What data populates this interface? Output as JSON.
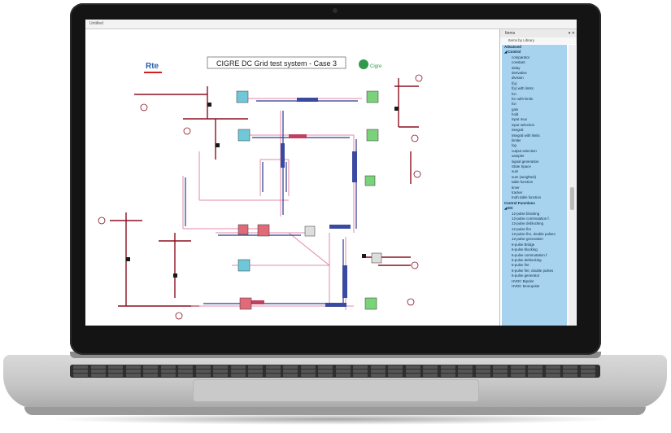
{
  "window": {
    "title": "Untitled"
  },
  "diagram": {
    "title": "CIGRE DC Grid test system - Case 3",
    "logo_left": "Rte",
    "logo_right": "Cigre"
  },
  "panel": {
    "title": "Items",
    "controls": "▾ ✕",
    "subheader": "Items by Library",
    "tree": [
      {
        "label": "Advanced",
        "kind": "h"
      },
      {
        "label": "◢ Control",
        "kind": "h"
      },
      {
        "label": "comparator",
        "kind": "i"
      },
      {
        "label": "constant",
        "kind": "i"
      },
      {
        "label": "delay",
        "kind": "i"
      },
      {
        "label": "derivative",
        "kind": "i"
      },
      {
        "label": "division",
        "kind": "i"
      },
      {
        "label": "f(u)",
        "kind": "i"
      },
      {
        "label": "f(u) with limits",
        "kind": "i"
      },
      {
        "label": "fcn",
        "kind": "i"
      },
      {
        "label": "fcn with limits",
        "kind": "i"
      },
      {
        "label": "fcn",
        "kind": "i"
      },
      {
        "label": "gain",
        "kind": "i"
      },
      {
        "label": "hold",
        "kind": "i"
      },
      {
        "label": "input mux",
        "kind": "i"
      },
      {
        "label": "input selection",
        "kind": "i"
      },
      {
        "label": "integral",
        "kind": "i"
      },
      {
        "label": "integral with limits",
        "kind": "i"
      },
      {
        "label": "limiter",
        "kind": "i"
      },
      {
        "label": "log",
        "kind": "i"
      },
      {
        "label": "output selection",
        "kind": "i"
      },
      {
        "label": "sampler",
        "kind": "i"
      },
      {
        "label": "signal generation",
        "kind": "i"
      },
      {
        "label": "State Space",
        "kind": "i"
      },
      {
        "label": "sum",
        "kind": "i"
      },
      {
        "label": "sum (weighted)",
        "kind": "i"
      },
      {
        "label": "table function",
        "kind": "i"
      },
      {
        "label": "timer",
        "kind": "i"
      },
      {
        "label": "tracker",
        "kind": "i"
      },
      {
        "label": "truth table function",
        "kind": "i"
      },
      {
        "label": "Control Functions",
        "kind": "h"
      },
      {
        "label": "◢ DC",
        "kind": "h"
      },
      {
        "label": "12-pulse blocking",
        "kind": "i"
      },
      {
        "label": "12-pulse commutation f.",
        "kind": "i"
      },
      {
        "label": "12-pulse deblocking",
        "kind": "i"
      },
      {
        "label": "12-pulse fire",
        "kind": "i"
      },
      {
        "label": "12-pulse fire, double pulses",
        "kind": "i"
      },
      {
        "label": "12-pulse generation",
        "kind": "i"
      },
      {
        "label": "6-pulse Bridge",
        "kind": "i"
      },
      {
        "label": "6-pulse blocking",
        "kind": "i"
      },
      {
        "label": "6-pulse commutation f.",
        "kind": "i"
      },
      {
        "label": "6-pulse deblocking",
        "kind": "i"
      },
      {
        "label": "6-pulse fire",
        "kind": "i"
      },
      {
        "label": "6-pulse fire, double pulses",
        "kind": "i"
      },
      {
        "label": "6-pulse generator",
        "kind": "i"
      },
      {
        "label": "HVDC Bipolar",
        "kind": "i"
      },
      {
        "label": "HVDC Monopolar",
        "kind": "i"
      }
    ]
  },
  "colors": {
    "bus": "#8a1020",
    "line_pink": "#e08aa8",
    "line_blue": "#2a3a8a",
    "converter_green": "#7ad27a",
    "converter_cyan": "#6fc8d8",
    "converter_red": "#e06a7a",
    "tree_bg": "#a7d3ee"
  }
}
